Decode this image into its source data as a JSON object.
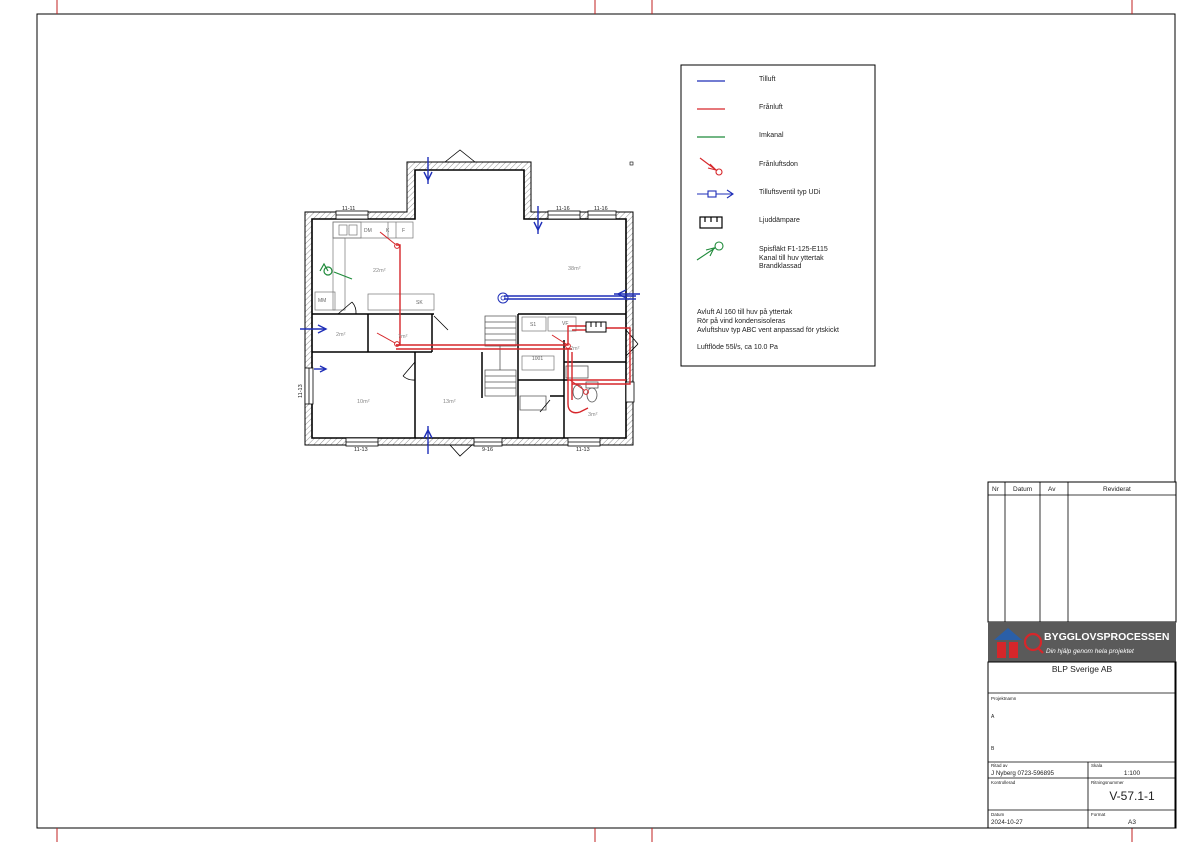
{
  "legend": {
    "items": [
      {
        "label": "Tilluft",
        "color": "#1f2fb8",
        "icon": "line-icon"
      },
      {
        "label": "Frånluft",
        "color": "#d6262a",
        "icon": "line-icon"
      },
      {
        "label": "Imkanal",
        "color": "#1f8a3a",
        "icon": "line-icon"
      },
      {
        "label": "Frånluftsdon",
        "color": "#d6262a",
        "icon": "exhaust-diffuser-icon"
      },
      {
        "label": "Tilluftsventil typ UDi",
        "color": "#1f2fb8",
        "icon": "supply-valve-icon"
      },
      {
        "label": "Ljuddämpare",
        "color": "#000000",
        "icon": "silencer-icon"
      },
      {
        "label": "Spisfläkt F1-125-E115",
        "color": "#1f8a3a",
        "icon": "hood-fan-icon"
      },
      {
        "label": "Kanal till huv yttertak",
        "color": "",
        "icon": ""
      },
      {
        "label": "Brandklassad",
        "color": "",
        "icon": ""
      }
    ],
    "notes": [
      "Avluft Al 160 till huv på yttertak",
      "Rör på vind kondensisoleras",
      "Avluftshuv typ ABC vent anpassad för ytskickt"
    ],
    "flow": "Luftflöde 55l/s, ca 10.0 Pa"
  },
  "plan": {
    "window_labels": [
      "11-11",
      "11-16",
      "11-16",
      "11-13",
      "11-13",
      "9-16",
      "11-13"
    ],
    "rooms": {
      "kitchen": "22m²",
      "living": "38m²",
      "small": "2m²",
      "room_b": "7m²",
      "bed_1": "10m²",
      "bed_2": "13m²",
      "bath": "3m²",
      "hall": "2m²"
    },
    "fixtures": [
      "DM",
      "K",
      "F",
      "MM",
      "SK",
      "S1",
      "VF",
      "1001"
    ]
  },
  "revision_table": {
    "headers": [
      "Nr",
      "Datum",
      "Av",
      "Reviderat"
    ]
  },
  "brand": {
    "name": "BYGGLOVSPROCESSEN",
    "tagline": "Din hjälp genom hela projektet",
    "company": "BLP Sverige AB",
    "accent": "#d6262a",
    "banner_bg": "#5a5a5a"
  },
  "title_block": {
    "project_label": "Projektnamn",
    "row_a_label": "A",
    "row_b_label": "B",
    "drawn_label": "Ritad av",
    "drawn_value": "J Nyberg 0723-596895",
    "scale_label": "Skala",
    "scale_value": "1:100",
    "checked_label": "Kontrollerad",
    "drawing_no_label": "Ritningsnummer",
    "drawing_no": "V-57.1-1",
    "date_label": "Datum",
    "date_value": "2024-10-27",
    "format_label": "Format",
    "format_value": "A3"
  }
}
